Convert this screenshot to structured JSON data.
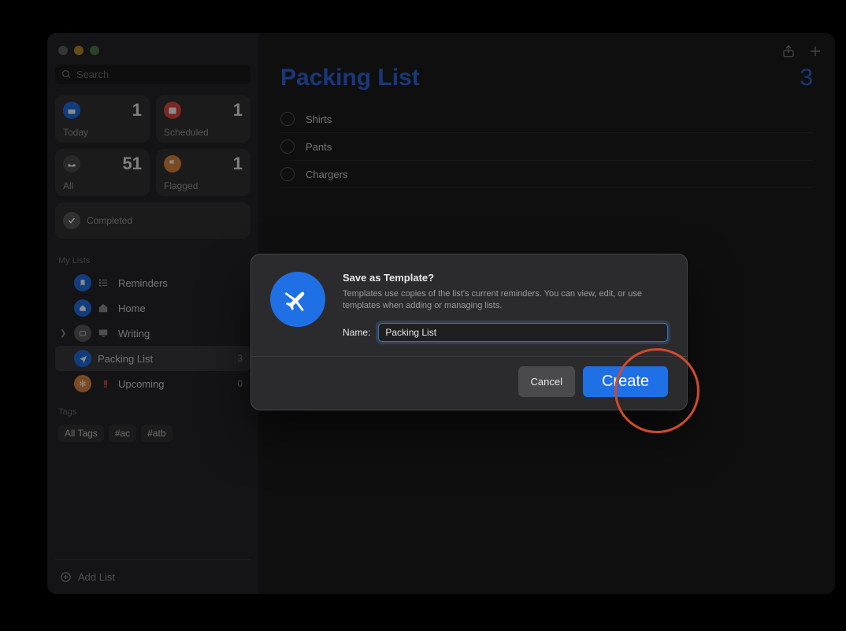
{
  "search_placeholder": "Search",
  "smart": {
    "today": {
      "label": "Today",
      "count": "1"
    },
    "scheduled": {
      "label": "Scheduled",
      "count": "1"
    },
    "all": {
      "label": "All",
      "count": "51"
    },
    "flagged": {
      "label": "Flagged",
      "count": "1"
    },
    "completed": {
      "label": "Completed"
    }
  },
  "mylists_header": "My Lists",
  "lists": {
    "reminders": {
      "label": "Reminders"
    },
    "home": {
      "label": "Home"
    },
    "writing": {
      "label": "Writing"
    },
    "packing": {
      "label": "Packing List",
      "count": "3"
    },
    "upcoming": {
      "label": "Upcoming",
      "count": "0"
    }
  },
  "tags_header": "Tags",
  "tags": [
    "All Tags",
    "#ac",
    "#atb"
  ],
  "add_list_label": "Add List",
  "page": {
    "title": "Packing List",
    "count": "3",
    "items": [
      "Shirts",
      "Pants",
      "Chargers"
    ]
  },
  "dialog": {
    "title": "Save as Template?",
    "desc": "Templates use copies of the list's current reminders. You can view, edit, or use templates when adding or managing lists.",
    "name_label": "Name:",
    "name_value": "Packing List",
    "cancel": "Cancel",
    "create": "Create"
  }
}
